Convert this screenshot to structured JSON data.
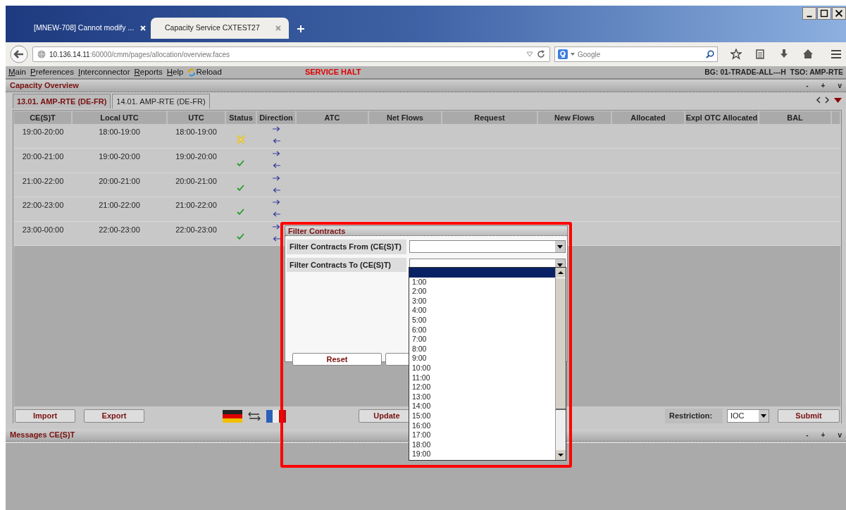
{
  "browser": {
    "tabs": [
      {
        "title": "[MNEW-708] Cannot modify ...",
        "selected": false
      },
      {
        "title": "Capacity Service CXTEST27",
        "selected": true
      }
    ],
    "url_host": "10.136.14.11",
    "url_path": ":60000/cmm/pages/allocation/overview.faces",
    "search_placeholder": "Google"
  },
  "menu": [
    {
      "label": "Main"
    },
    {
      "label": "Preferences"
    },
    {
      "label": "Interconnector"
    },
    {
      "label": "Reports"
    },
    {
      "label": "Help"
    }
  ],
  "reload_label": "Reload",
  "service_status": "SERVICE HALT",
  "session_info": "BG: 01-TRADE-ALL---H  TSO: AMP-RTE",
  "capacity_panel": {
    "title": "Capacity Overview",
    "controls": [
      "-",
      "+",
      "v"
    ],
    "day_tabs": [
      {
        "label": "13.01. AMP-RTE (DE-FR)",
        "selected": true
      },
      {
        "label": "14.01. AMP-RTE (DE-FR)",
        "selected": false
      }
    ],
    "columns": [
      "CE(S)T",
      "Local UTC",
      "UTC",
      "Status",
      "Direction",
      "ATC",
      "Net Flows",
      "Request",
      "New Flows",
      "Allocated",
      "Expl OTC Allocated",
      "BAL"
    ],
    "rows": [
      {
        "cest": "19:00-20:00",
        "local_utc": "18:00-19:00",
        "utc": "18:00-19:00",
        "kind": "warning"
      },
      {
        "cest": "20:00-21:00",
        "local_utc": "19:00-20:00",
        "utc": "19:00-20:00",
        "kind": "ok"
      },
      {
        "cest": "21:00-22:00",
        "local_utc": "20:00-21:00",
        "utc": "20:00-21:00",
        "kind": "ok"
      },
      {
        "cest": "22:00-23:00",
        "local_utc": "21:00-22:00",
        "utc": "21:00-22:00",
        "kind": "ok"
      },
      {
        "cest": "23:00-00:00",
        "local_utc": "22:00-23:00",
        "utc": "22:00-23:00",
        "kind": "ok"
      }
    ],
    "buttons_left": [
      "Import",
      "Export"
    ],
    "update_label": "Update",
    "restriction_label": "Restriction:",
    "restriction_value": "IOC",
    "submit_label": "Submit"
  },
  "messages_panel": {
    "title": "Messages CE(S)T",
    "controls": [
      "-",
      "+",
      "v"
    ]
  },
  "filter_dialog": {
    "title": "Filter Contracts",
    "fields": [
      "Filter Contracts From (CE(S)T)",
      "Filter Contracts To (CE(S)T)"
    ],
    "reset_label": "Reset",
    "dropdown": {
      "blank_option_selected": true,
      "options": [
        "1:00",
        "2:00",
        "3:00",
        "4:00",
        "5:00",
        "6:00",
        "7:00",
        "8:00",
        "9:00",
        "10:00",
        "11:00",
        "12:00",
        "13:00",
        "14:00",
        "15:00",
        "16:00",
        "17:00",
        "18:00",
        "19:00"
      ]
    }
  }
}
